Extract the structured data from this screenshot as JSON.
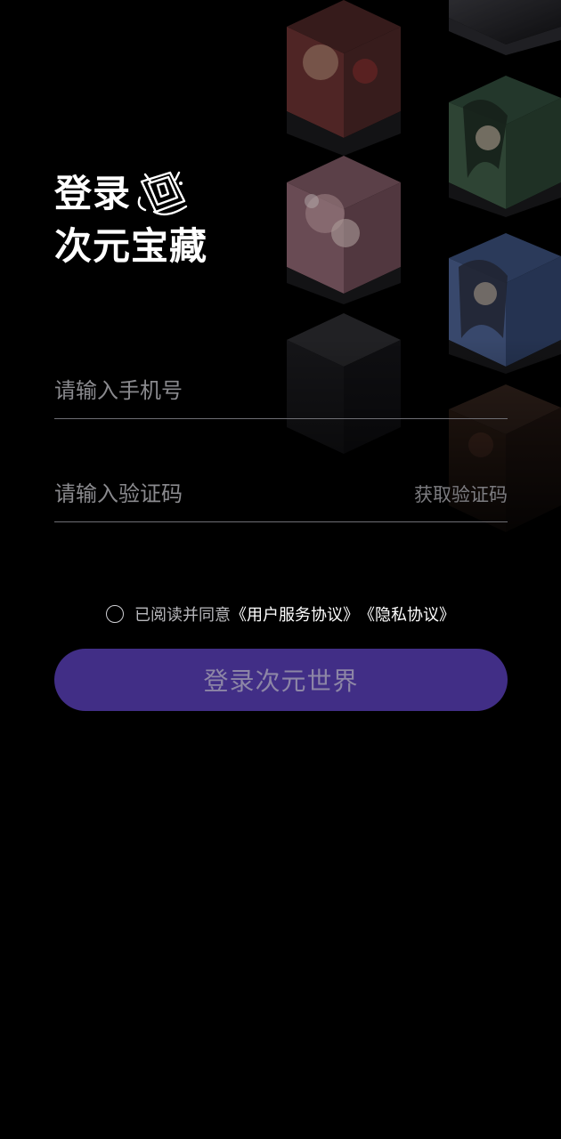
{
  "header": {
    "title_line1": "登录",
    "title_line2": "次元宝藏",
    "title_icon": "ticket-icon"
  },
  "form": {
    "phone_placeholder": "请输入手机号",
    "code_placeholder": "请输入验证码",
    "get_code_label": "获取验证码"
  },
  "agreement": {
    "prefix": "已阅读并同意",
    "terms_link": "《用户服务协议》",
    "privacy_link": "《隐私协议》"
  },
  "login_button": {
    "label": "登录次元世界"
  },
  "colors": {
    "background": "#000000",
    "button": "#412e86",
    "button_text": "#8d86a6"
  }
}
